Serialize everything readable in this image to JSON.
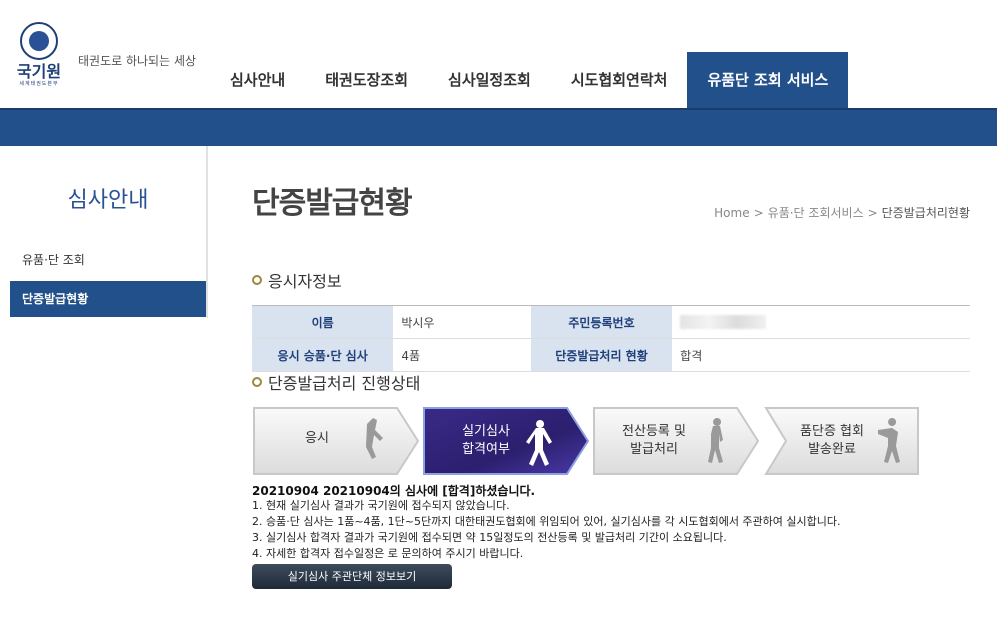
{
  "header": {
    "logo_text": "국기원",
    "logo_sub": "세계태권도본부",
    "slogan": "태권도로 하나되는 세상",
    "nav": [
      "심사안내",
      "태권도장조회",
      "심사일정조회",
      "시도협회연락처",
      "유품단 조회 서비스"
    ],
    "active_nav": 4,
    "accent": "#22508b"
  },
  "sidebar": {
    "title": "심사안내",
    "items": [
      "유품·단 조회",
      "단증발급현황"
    ],
    "active": 1
  },
  "page": {
    "title": "단증발급현황",
    "breadcrumb": [
      "Home",
      "유품·단 조회서비스",
      "단증발급처리현황"
    ]
  },
  "applicant": {
    "heading": "응시자정보",
    "rows": [
      {
        "label1": "이름",
        "value1": "박시우",
        "label2": "주민등록번호",
        "value2": ""
      },
      {
        "label1": "응시 승품·단 심사",
        "value1": "4품",
        "label2": "단증발급처리 현황",
        "value2": "합격"
      }
    ]
  },
  "progress": {
    "heading": "단증발급처리 진행상태",
    "steps": [
      {
        "line1": "응시",
        "line2": ""
      },
      {
        "line1": "실기심사",
        "line2": "합격여부"
      },
      {
        "line1": "전산등록 및",
        "line2": "발급처리"
      },
      {
        "line1": "품단증 협회",
        "line2": "발송완료"
      }
    ],
    "active_step": 1
  },
  "result": {
    "headline": "20210904 20210904의 심사에 [합격]하셨습니다.",
    "notes": [
      "1. 현재 실기심사 결과가 국기원에 접수되지 않았습니다.",
      "2. 승품·단 심사는 1품~4품, 1단~5단까지 대한태권도협회에 위임되어 있어, 실기심사를 각 시도협회에서 주관하여 실시합니다.",
      "3. 실기심사 합격자 결과가 국기원에 접수되면 약 15일정도의 전산등록 및 발급처리 기간이 소요됩니다.",
      "4. 자세한 합격자 접수일정은 로 문의하여 주시기 바랍니다."
    ],
    "button": "실기심사 주관단체 정보보기"
  }
}
